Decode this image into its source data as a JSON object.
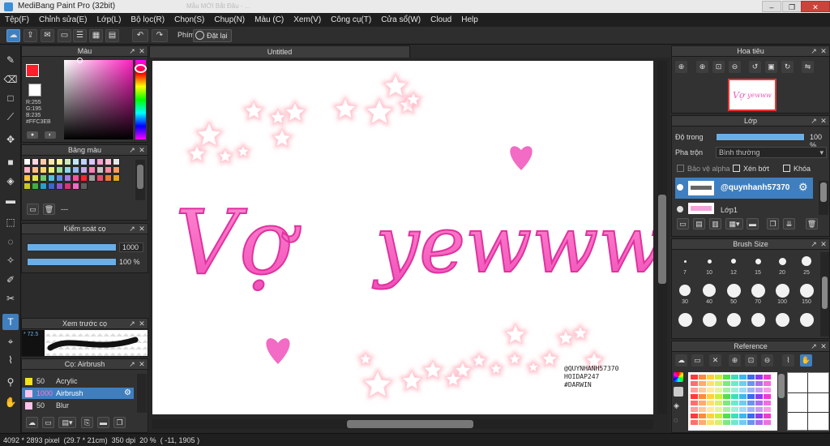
{
  "title": "MediBang Paint Pro (32bit)",
  "title_ghost": "Mẫu MỚI Bắt Đầu - ...",
  "menu": [
    "Tệp(F)",
    "Chỉnh sửa(E)",
    "Lớp(L)",
    "Bộ lọc(R)",
    "Chọn(S)",
    "Chụp(N)",
    "Màu (C)",
    "Xem(V)",
    "Công cụ(T)",
    "Cửa sổ(W)",
    "Cloud",
    "Help"
  ],
  "toolbar": {
    "key_label": "Phím",
    "reset_label": "Đặt lại"
  },
  "panels": {
    "color": {
      "title": "Màu",
      "r": "R:255",
      "g": "G:195",
      "b": "B:235",
      "hex": "#FFC3EB"
    },
    "palette": {
      "title": "Bảng màu",
      "footer": "---"
    },
    "brush_control": {
      "title": "Kiểm soát cọ",
      "size": "1000",
      "opacity": "100 %"
    },
    "brush_preview": {
      "title": "Xem trước cọ",
      "value": "* 72.5"
    },
    "brush_list": {
      "title": "Cọ: Airbrush",
      "items": [
        {
          "size": "50",
          "name": "Acrylic",
          "color": "#f5e021"
        },
        {
          "size": "1000",
          "name": "Airbrush",
          "color": "#ffc3eb",
          "active": true
        },
        {
          "size": "50",
          "name": "Blur",
          "color": "#ffc3eb"
        }
      ]
    },
    "navigator": {
      "title": "Hoa tiêu"
    },
    "layer": {
      "title": "Lớp",
      "opacity_label": "Độ trong",
      "opacity_value": "100 %",
      "blend_label": "Pha trộn",
      "blend_value": "Bình thường",
      "protect_alpha": "Bảo vệ alpha",
      "clip": "Xén bớt",
      "lock": "Khóa",
      "layers": [
        {
          "name": "@quynhanh57370",
          "active": true
        },
        {
          "name": "Lớp1",
          "active": false
        }
      ]
    },
    "brush_size": {
      "title": "Brush Size",
      "sizes": [
        "7",
        "10",
        "12",
        "15",
        "20",
        "25",
        "30",
        "40",
        "50",
        "70",
        "100",
        "150",
        "",
        "",
        "",
        "",
        "",
        ""
      ]
    },
    "reference": {
      "title": "Reference"
    }
  },
  "canvas": {
    "tab": "Untitled",
    "text1": "Vợ",
    "text2": "yewww",
    "credit": [
      "@QUYNHANH57370",
      "HOIDAP247",
      "#DARWIN"
    ]
  },
  "status": {
    "size": "4092 * 2893 pixel",
    "cm": "(29.7 * 21cm)",
    "dpi": "350 dpi",
    "zoom": "20 %",
    "coords": "( -11, 1905 )"
  },
  "colors": {
    "accent": "#3f7fbf",
    "pink": "#f06bc3",
    "selected_fg": "#ff1f2a"
  }
}
